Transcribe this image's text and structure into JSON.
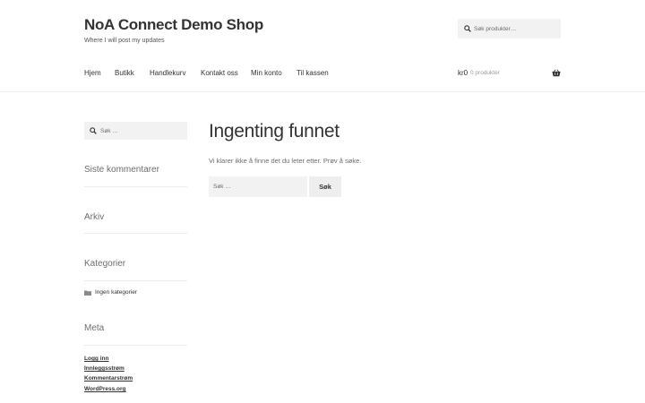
{
  "site": {
    "title": "NoA Connect Demo Shop",
    "tagline": "Where I will post my updates"
  },
  "product_search": {
    "placeholder": "Søk produkter…",
    "icon": "search-icon"
  },
  "nav": {
    "items": [
      {
        "label": "Hjem"
      },
      {
        "label": "Butikk"
      },
      {
        "label": "Handlekurv"
      },
      {
        "label": "Kontakt oss"
      },
      {
        "label": "Min konto"
      },
      {
        "label": "Til kassen"
      }
    ]
  },
  "cart": {
    "amount": "kr0",
    "count": "0 produkter",
    "icon": "basket-icon"
  },
  "sidebar": {
    "search": {
      "placeholder": "Søk …",
      "icon": "search-icon"
    },
    "widgets": {
      "recent_comments": "Siste kommentarer",
      "archive": "Arkiv",
      "categories": "Kategorier",
      "meta": "Meta"
    },
    "categories": [
      {
        "label": "Ingen kategorier",
        "icon": "folder-icon"
      }
    ],
    "meta_links": [
      {
        "label": "Logg inn"
      },
      {
        "label": "Innleggsstrøm"
      },
      {
        "label": "Kommentarstrøm"
      },
      {
        "label": "WordPress.org"
      }
    ]
  },
  "main": {
    "title": "Ingenting funnet",
    "message": "Vi klarer ikke å finne det du leter etter. Prøv å søke.",
    "search": {
      "placeholder": "Søk …",
      "button_label": "Søk"
    }
  },
  "colors": {
    "text": "#333333",
    "muted": "#6d6d6d",
    "field_bg": "#f2f2f2",
    "button_bg": "#eeeeee"
  }
}
